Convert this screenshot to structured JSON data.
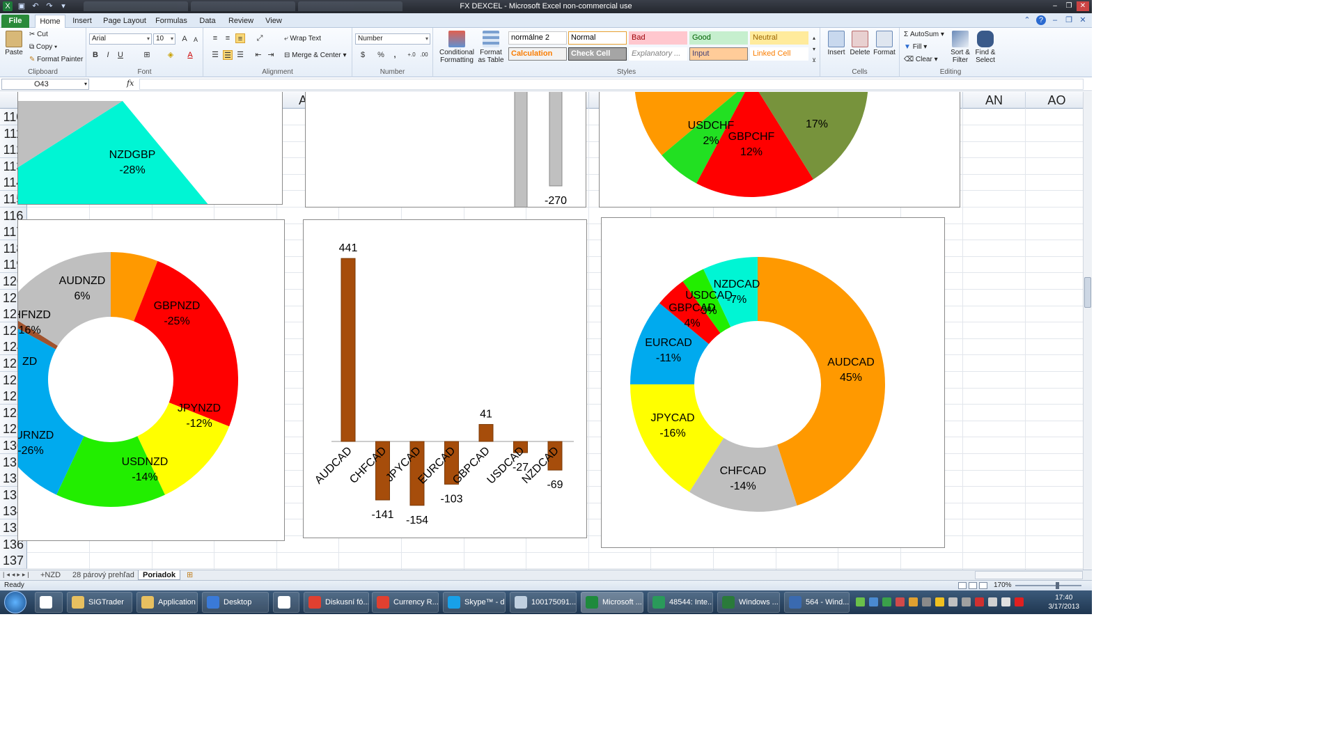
{
  "window": {
    "title": "FX DEXCEL  -  Microsoft Excel non-commercial use"
  },
  "ribbon_tabs": [
    "File",
    "Home",
    "Insert",
    "Page Layout",
    "Formulas",
    "Data",
    "Review",
    "View"
  ],
  "ribbon": {
    "clipboard": {
      "paste": "Paste",
      "cut": "Cut",
      "copy": "Copy",
      "format_painter": "Format Painter",
      "label": "Clipboard"
    },
    "font": {
      "name": "Arial",
      "size": "10",
      "bold": "B",
      "italic": "I",
      "underline": "U",
      "label": "Font"
    },
    "alignment": {
      "wrap_text": "Wrap Text",
      "merge_center": "Merge & Center",
      "label": "Alignment"
    },
    "number": {
      "format": "Number",
      "currency": "$",
      "percent": "%",
      "comma": ",",
      "label": "Number"
    },
    "styles": {
      "conditional": "Conditional Formatting",
      "format_table": "Format as Table",
      "label": "Styles",
      "cells": [
        {
          "text": "normálne 2",
          "bg": "#ffffff",
          "fg": "#000000",
          "border": "#c8c8c8"
        },
        {
          "text": "Normal",
          "bg": "#ffffff",
          "fg": "#000000",
          "border": "#e8a030"
        },
        {
          "text": "Bad",
          "bg": "#ffc7ce",
          "fg": "#9c0006",
          "border": "#ffc7ce"
        },
        {
          "text": "Good",
          "bg": "#c6efce",
          "fg": "#006100",
          "border": "#c6efce"
        },
        {
          "text": "Neutral",
          "bg": "#ffeb9c",
          "fg": "#9c6500",
          "border": "#ffeb9c"
        },
        {
          "text": "Calculation",
          "bg": "#f2f2f2",
          "fg": "#fa7d00",
          "border": "#7f7f7f"
        },
        {
          "text": "Check Cell",
          "bg": "#a5a5a5",
          "fg": "#ffffff",
          "border": "#3f3f3f"
        },
        {
          "text": "Explanatory ...",
          "bg": "#ffffff",
          "fg": "#7f7f7f",
          "border": "#ffffff"
        },
        {
          "text": "Input",
          "bg": "#ffcc99",
          "fg": "#3f3f76",
          "border": "#7f7f7f"
        },
        {
          "text": "Linked Cell",
          "bg": "#ffffff",
          "fg": "#fa7d00",
          "border": "#ffffff"
        }
      ]
    },
    "cells": {
      "insert": "Insert",
      "delete": "Delete",
      "format": "Format",
      "label": "Cells"
    },
    "editing": {
      "autosum": "AutoSum",
      "fill": "Fill",
      "clear": "Clear",
      "sort_filter": "Sort & Filter",
      "find_select": "Find & Select",
      "label": "Editing"
    }
  },
  "formula_bar": {
    "name_box": "O43",
    "fx": "fx",
    "formula": ""
  },
  "columns": [
    "Y",
    "Z",
    "AA",
    "AB",
    "AC",
    "AD",
    "AE",
    "AF",
    "AG",
    "AH",
    "AI",
    "AJ",
    "AK",
    "AL",
    "AM",
    "AN",
    "AO"
  ],
  "rows": [
    "110",
    "111",
    "112",
    "113",
    "114",
    "115",
    "116",
    "117",
    "118",
    "119",
    "120",
    "121",
    "122",
    "123",
    "124",
    "125",
    "126",
    "127",
    "128",
    "129",
    "130",
    "131",
    "132",
    "133",
    "134",
    "135",
    "136",
    "137"
  ],
  "chart_data": [
    {
      "type": "pie",
      "title": "",
      "partial": true,
      "slices": [
        {
          "label": "NZDGBP",
          "value": -28,
          "text": "-28%",
          "color": "#00f5d4"
        }
      ]
    },
    {
      "type": "bar",
      "title": "",
      "partial": true,
      "bars": [
        {
          "label": "",
          "value": -429
        },
        {
          "label": "",
          "value": -270
        }
      ],
      "color": "#c0c0c0"
    },
    {
      "type": "pie",
      "title": "",
      "partial": true,
      "slices": [
        {
          "label": "USDCHF",
          "value": 2,
          "text": "2%",
          "color": "#22e022"
        },
        {
          "label": "GBPCHF",
          "value": 12,
          "text": "12%",
          "color": "#ff0000"
        },
        {
          "label": "",
          "value": 17,
          "text": "17%",
          "color": "#77933c"
        }
      ]
    },
    {
      "type": "pie",
      "title": "",
      "donut": true,
      "slices": [
        {
          "label": "AUDNZD",
          "value": 6,
          "text": "6%",
          "color": "#ff9900"
        },
        {
          "label": "GBPNZD",
          "value": -25,
          "text": "-25%",
          "color": "#ff0000"
        },
        {
          "label": "JPYNZD",
          "value": -12,
          "text": "-12%",
          "color": "#ffff00"
        },
        {
          "label": "USDNZD",
          "value": -14,
          "text": "-14%",
          "color": "#22ee00"
        },
        {
          "label": "EURNZD",
          "value": -26,
          "text": "-26%",
          "color": "#00aaee"
        },
        {
          "label": "CADNZD",
          "value": -1,
          "text": "",
          "color": "#a0522d"
        },
        {
          "label": "CHFNZD",
          "value": -16,
          "text": "-16%",
          "color": "#bfbfbf"
        }
      ],
      "visible_labels": [
        "AUDNZD 6%",
        "GBPNZD -25%",
        "JPYNZD -12%",
        "USDNZD -14%",
        "RNZD 26%",
        "ZD",
        "FNZD .6%"
      ]
    },
    {
      "type": "bar",
      "title": "",
      "categories": [
        "AUDCAD",
        "CHFCAD",
        "JPYCAD",
        "EURCAD",
        "GBPCAD",
        "USDCAD",
        "NZDCAD"
      ],
      "values": [
        441,
        -141,
        -154,
        -103,
        41,
        -27,
        -69
      ],
      "color": "#a64d0b"
    },
    {
      "type": "pie",
      "title": "",
      "donut": true,
      "slices": [
        {
          "label": "AUDCAD",
          "value": 45,
          "text": "45%",
          "color": "#ff9900"
        },
        {
          "label": "CHFCAD",
          "value": -14,
          "text": "-14%",
          "color": "#bfbfbf"
        },
        {
          "label": "JPYCAD",
          "value": -16,
          "text": "-16%",
          "color": "#ffff00"
        },
        {
          "label": "EURCAD",
          "value": -11,
          "text": "-11%",
          "color": "#00aaee"
        },
        {
          "label": "GBPCAD",
          "value": 4,
          "text": "4%",
          "color": "#ff0000"
        },
        {
          "label": "USDCAD",
          "value": 3,
          "text": "3%",
          "color": "#22ee00"
        },
        {
          "label": "NZDCAD",
          "value": -7,
          "text": "-7%",
          "color": "#00f5d4"
        }
      ]
    }
  ],
  "sheet_tabs": [
    "+NZD",
    "28 párový prehľad",
    "Poriadok"
  ],
  "active_sheet": "Poriadok",
  "status": {
    "ready": "Ready",
    "zoom": "170%"
  },
  "taskbar": {
    "items": [
      {
        "label": "",
        "color": "#ffffff"
      },
      {
        "label": "SIGTrader",
        "color": "#e8c060"
      },
      {
        "label": "Application",
        "color": "#e8c060"
      },
      {
        "label": "Desktop",
        "color": "#3a7ad8"
      },
      {
        "label": "",
        "color": "#ffffff"
      },
      {
        "label": "Diskusní fó...",
        "color": "#e04030"
      },
      {
        "label": "Currency R...",
        "color": "#e04030"
      },
      {
        "label": "Skype™ - d...",
        "color": "#18a0e8"
      },
      {
        "label": "100175091...",
        "color": "#c0d0e0"
      },
      {
        "label": "Microsoft ...",
        "color": "#1e8a3c"
      },
      {
        "label": "48544: Inte...",
        "color": "#2a9a5a"
      },
      {
        "label": "Windows ...",
        "color": "#2a7a3a"
      },
      {
        "label": "564 - Wind...",
        "color": "#3a6ab0"
      }
    ],
    "time": "17:40",
    "date": "3/17/2013"
  }
}
